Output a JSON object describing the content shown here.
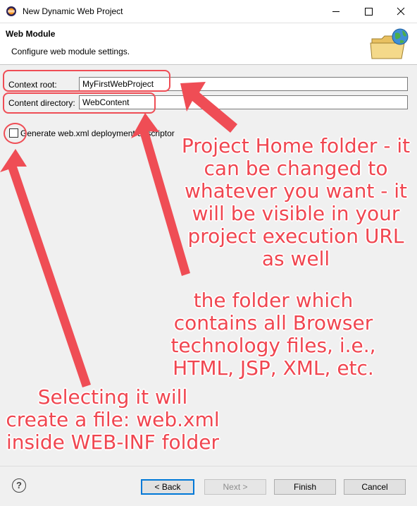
{
  "window": {
    "title": "New Dynamic Web Project",
    "app_icon": "eclipse-icon",
    "controls": [
      "minimize-icon",
      "maximize-icon",
      "close-icon"
    ]
  },
  "banner": {
    "title": "Web Module",
    "description": "Configure web module settings.",
    "icon": "folder-globe-icon"
  },
  "form": {
    "context_root_label": "Context root:",
    "context_root_value": "MyFirstWebProject",
    "content_directory_label": "Content directory:",
    "content_directory_value": "WebContent",
    "generate_checkbox_label": "Generate web.xml deployment descriptor",
    "generate_checked": false
  },
  "annotations": {
    "project_home": "Project Home folder - it can be changed to whatever you want - it will be visible in your project execution URL as well",
    "content_folder": "the folder which contains all Browser technology files, i.e., HTML, JSP, XML, etc.",
    "web_xml": "Selecting it will create a file: web.xml inside WEB-INF folder",
    "color": "#ef4d55"
  },
  "buttons": {
    "back": "< Back",
    "next": "Next >",
    "finish": "Finish",
    "cancel": "Cancel",
    "help_icon": "help-icon"
  }
}
